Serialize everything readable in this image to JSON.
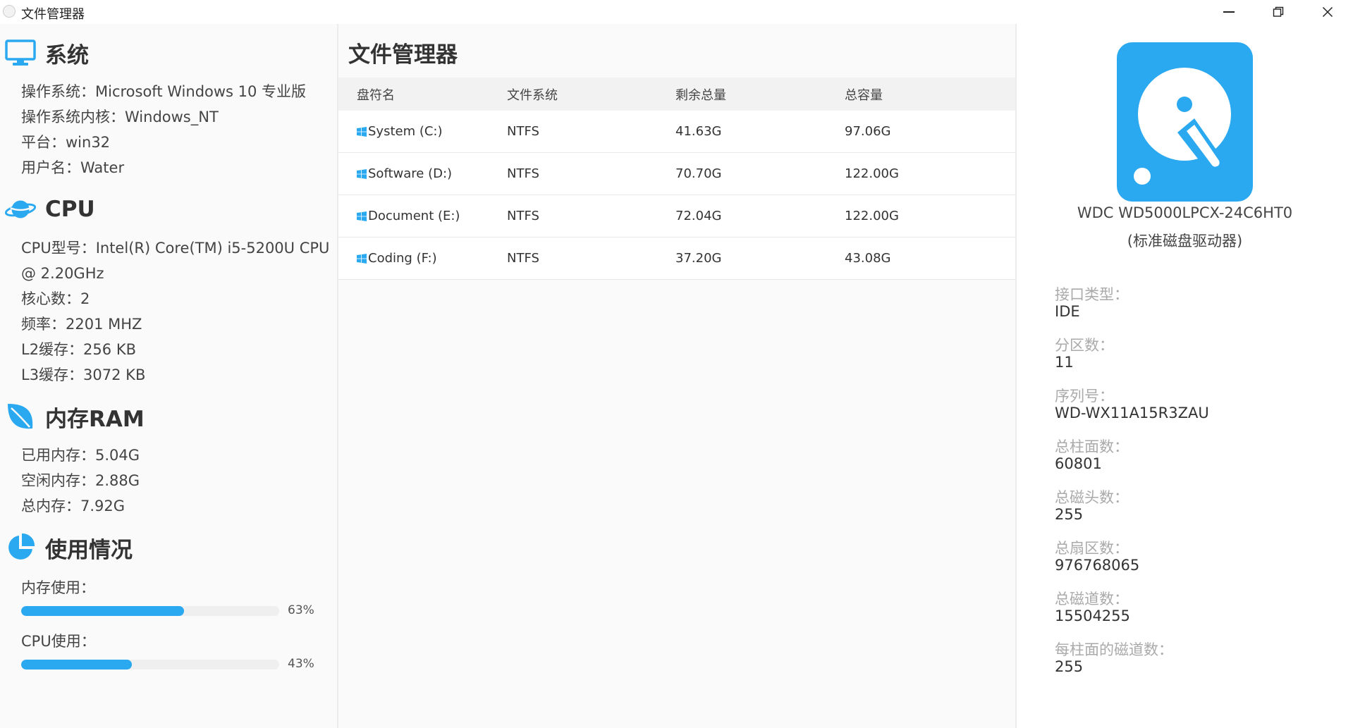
{
  "window": {
    "title": "文件管理器"
  },
  "system": {
    "title": "系统",
    "os": "操作系统：Microsoft Windows 10 专业版",
    "kernel": "操作系统内核：Windows_NT",
    "platform": "平台：win32",
    "user": "用户名：Water"
  },
  "cpu": {
    "title": "CPU",
    "model_line1": "CPU型号：Intel(R) Core(TM) i5-5200U CPU",
    "model_line2": "@ 2.20GHz",
    "cores": "核心数：2",
    "freq": "频率：2201 MHZ",
    "l2": "L2缓存：256 KB",
    "l3": "L3缓存：3072 KB"
  },
  "ram": {
    "title": "内存RAM",
    "used": "已用内存：5.04G",
    "free": "空闲内存：2.88G",
    "total": "总内存：7.92G"
  },
  "usage": {
    "title": "使用情况",
    "mem_label": "内存使用：",
    "mem_value": 63,
    "mem_pct": "63%",
    "cpu_label": "CPU使用：",
    "cpu_value": 43,
    "cpu_pct": "43%"
  },
  "files": {
    "title": "文件管理器",
    "columns": [
      "盘符名",
      "文件系统",
      "剩余总量",
      "总容量"
    ],
    "rows": [
      {
        "name": "System (C:)",
        "fs": "NTFS",
        "free": "41.63G",
        "total": "97.06G"
      },
      {
        "name": "Software (D:)",
        "fs": "NTFS",
        "free": "70.70G",
        "total": "122.00G"
      },
      {
        "name": "Document (E:)",
        "fs": "NTFS",
        "free": "72.04G",
        "total": "122.00G"
      },
      {
        "name": "Coding (F:)",
        "fs": "NTFS",
        "free": "37.20G",
        "total": "43.08G"
      }
    ]
  },
  "disk": {
    "name": "WDC WD5000LPCX-24C6HT0",
    "type": "(标准磁盘驱动器)",
    "props": [
      {
        "label": "接口类型：",
        "value": "IDE"
      },
      {
        "label": "分区数：",
        "value": "11"
      },
      {
        "label": "序列号：",
        "value": "WD-WX11A15R3ZAU"
      },
      {
        "label": "总柱面数：",
        "value": "60801"
      },
      {
        "label": "总磁头数：",
        "value": "255"
      },
      {
        "label": "总扇区数：",
        "value": "976768065"
      },
      {
        "label": "总磁道数：",
        "value": "15504255"
      },
      {
        "label": "每柱面的磁道数：",
        "value": "255"
      }
    ]
  },
  "icons": [
    "app-icon",
    "monitor-icon",
    "planet-icon",
    "leaf-icon",
    "pie-chart-icon",
    "windows-icon",
    "hard-disk-icon",
    "minimize-icon",
    "maximize-icon",
    "close-icon"
  ],
  "colors": {
    "accent": "#2aa9f0",
    "progress_fill": "#2aa9f0"
  }
}
